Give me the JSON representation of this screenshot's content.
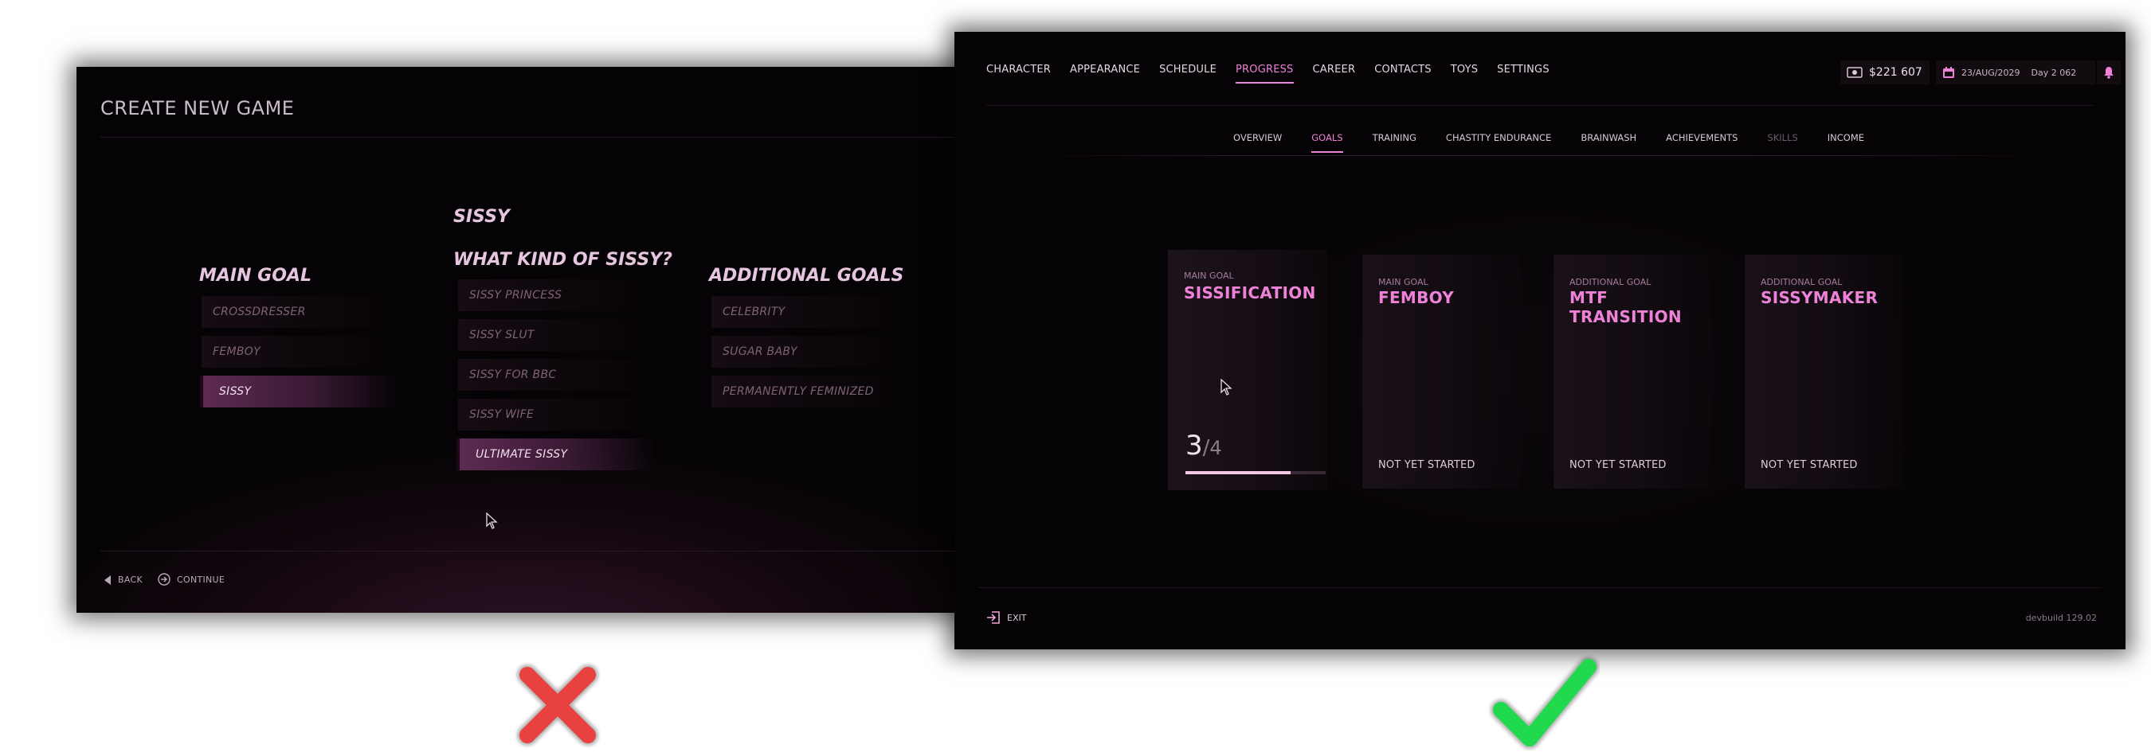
{
  "left": {
    "title": "CREATE NEW GAME",
    "main_goal": {
      "heading": "MAIN GOAL",
      "options": [
        "CROSSDRESSER",
        "FEMBOY",
        "SISSY"
      ],
      "selected": "SISSY"
    },
    "sissy": {
      "heading": "SISSY",
      "subheading": "WHAT KIND OF SISSY?",
      "options": [
        "SISSY PRINCESS",
        "SISSY SLUT",
        "SISSY FOR BBC",
        "SISSY WIFE",
        "ULTIMATE SISSY"
      ],
      "selected": "ULTIMATE SISSY"
    },
    "additional": {
      "heading": "ADDITIONAL GOALS",
      "options": [
        "CELEBRITY",
        "SUGAR BABY",
        "PERMANENTLY FEMINIZED"
      ]
    },
    "back_label": "BACK",
    "continue_label": "CONTINUE"
  },
  "right": {
    "tabs": [
      "CHARACTER",
      "APPEARANCE",
      "SCHEDULE",
      "PROGRESS",
      "CAREER",
      "CONTACTS",
      "TOYS",
      "SETTINGS"
    ],
    "active_tab": "PROGRESS",
    "money": "$221 607",
    "date": "23/AUG/2029",
    "day": "Day  2 062",
    "subtabs": [
      "OVERVIEW",
      "GOALS",
      "TRAINING",
      "CHASTITY ENDURANCE",
      "BRAINWASH",
      "ACHIEVEMENTS",
      "SKILLS",
      "INCOME"
    ],
    "active_subtab": "GOALS",
    "disabled_subtab": "SKILLS",
    "cards": [
      {
        "kind": "MAIN GOAL",
        "name": "SISSIFICATION",
        "progress_current": "3",
        "progress_sep": "/",
        "progress_total": "4",
        "progress_fraction": 0.75
      },
      {
        "kind": "MAIN GOAL",
        "name": "FEMBOY",
        "status": "NOT YET STARTED"
      },
      {
        "kind": "ADDITIONAL GOAL",
        "name": "MTF TRANSITION",
        "status": "NOT YET STARTED"
      },
      {
        "kind": "ADDITIONAL GOAL",
        "name": "SISSYMAKER",
        "status": "NOT YET STARTED"
      }
    ],
    "exit_label": "EXIT",
    "build": "devbuild 129.02"
  },
  "colors": {
    "accent_pink": "#ee82d8",
    "selected_bg": "#5e2a53",
    "reject_red": "#e8413f",
    "approve_green": "#21d94c"
  },
  "icons": {
    "back": "triangle-left-icon",
    "continue": "circle-arrow-icon",
    "money": "cash-icon",
    "calendar": "calendar-icon",
    "bell": "bell-icon",
    "exit": "exit-icon",
    "reject": "red-x-icon",
    "approve": "green-check-icon"
  }
}
